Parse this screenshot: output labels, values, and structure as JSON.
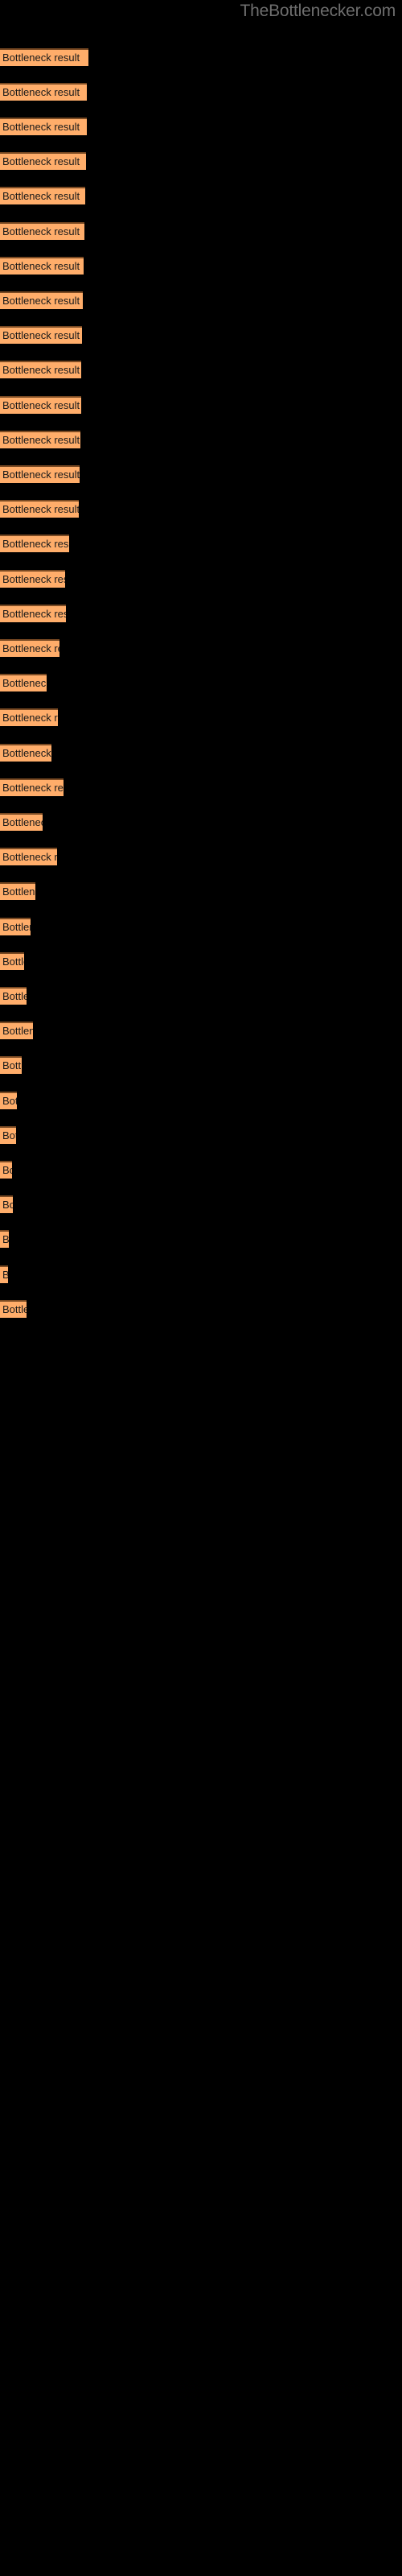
{
  "watermark": {
    "text": "TheBottlenecker.com",
    "color": "#6e6e6e"
  },
  "colors": {
    "background": "#000000",
    "bar_fill": "#ffad6a",
    "bar_border": "#7a4a23",
    "label_text": "#1a1a1a"
  },
  "chart_data": {
    "type": "bar",
    "orientation": "horizontal",
    "title": "",
    "subtitle": "",
    "xlabel": "",
    "ylabel": "",
    "grid": false,
    "legend": null,
    "axis_visible": false,
    "tick_labels": [],
    "xlim": [
      0,
      500
    ],
    "bar_label_text": "Bottleneck result",
    "categories": [
      "Bottleneck result",
      "Bottleneck result",
      "Bottleneck result",
      "Bottleneck result",
      "Bottleneck result",
      "Bottleneck result",
      "Bottleneck result",
      "Bottleneck result",
      "Bottleneck result",
      "Bottleneck result",
      "Bottleneck result",
      "Bottleneck result",
      "Bottleneck result",
      "Bottleneck result",
      "Bottleneck result",
      "Bottleneck result",
      "Bottleneck result",
      "Bottleneck result",
      "Bottleneck result",
      "Bottleneck result",
      "Bottleneck result",
      "Bottleneck result",
      "Bottleneck result",
      "Bottleneck result",
      "Bottleneck result",
      "Bottleneck result",
      "Bottleneck result",
      "Bottleneck result",
      "Bottleneck result",
      "Bottleneck result",
      "Bottleneck result",
      "Bottleneck result",
      "Bottleneck result",
      "Bottleneck result",
      "Bottleneck result",
      "Bottleneck result",
      "Bottleneck result"
    ],
    "values": [
      110,
      108,
      108,
      107,
      106,
      105,
      104,
      103,
      102,
      101,
      101,
      100,
      99,
      98,
      86,
      81,
      82,
      74,
      58,
      72,
      64,
      79,
      53,
      71,
      44,
      38,
      30,
      33,
      41,
      27,
      21,
      20,
      15,
      16,
      11,
      10,
      33
    ],
    "bars": [
      {
        "label": "Bottleneck result",
        "y": 60,
        "width": 110
      },
      {
        "label": "Bottleneck result",
        "y": 103,
        "width": 108
      },
      {
        "label": "Bottleneck result",
        "y": 146,
        "width": 108
      },
      {
        "label": "Bottleneck result",
        "y": 189,
        "width": 107
      },
      {
        "label": "Bottleneck result",
        "y": 232,
        "width": 106
      },
      {
        "label": "Bottleneck result",
        "y": 276,
        "width": 105
      },
      {
        "label": "Bottleneck result",
        "y": 319,
        "width": 104
      },
      {
        "label": "Bottleneck result",
        "y": 362,
        "width": 103
      },
      {
        "label": "Bottleneck result",
        "y": 405,
        "width": 102
      },
      {
        "label": "Bottleneck result",
        "y": 448,
        "width": 101
      },
      {
        "label": "Bottleneck result",
        "y": 492,
        "width": 101
      },
      {
        "label": "Bottleneck result",
        "y": 535,
        "width": 100
      },
      {
        "label": "Bottleneck result",
        "y": 578,
        "width": 99
      },
      {
        "label": "Bottleneck result",
        "y": 621,
        "width": 98
      },
      {
        "label": "Bottleneck result",
        "y": 664,
        "width": 86
      },
      {
        "label": "Bottleneck result",
        "y": 708,
        "width": 81
      },
      {
        "label": "Bottleneck result",
        "y": 751,
        "width": 82
      },
      {
        "label": "Bottleneck result",
        "y": 794,
        "width": 74
      },
      {
        "label": "Bottleneck result",
        "y": 837,
        "width": 58
      },
      {
        "label": "Bottleneck result",
        "y": 880,
        "width": 72
      },
      {
        "label": "Bottleneck result",
        "y": 924,
        "width": 64
      },
      {
        "label": "Bottleneck result",
        "y": 967,
        "width": 79
      },
      {
        "label": "Bottleneck result",
        "y": 1010,
        "width": 53
      },
      {
        "label": "Bottleneck result",
        "y": 1053,
        "width": 71
      },
      {
        "label": "Bottleneck result",
        "y": 1096,
        "width": 44
      },
      {
        "label": "Bottleneck result",
        "y": 1140,
        "width": 38
      },
      {
        "label": "Bottleneck result",
        "y": 1183,
        "width": 30
      },
      {
        "label": "Bottleneck result",
        "y": 1226,
        "width": 33
      },
      {
        "label": "Bottleneck result",
        "y": 1269,
        "width": 41
      },
      {
        "label": "Bottleneck result",
        "y": 1312,
        "width": 27
      },
      {
        "label": "Bottleneck result",
        "y": 1356,
        "width": 21
      },
      {
        "label": "Bottleneck result",
        "y": 1399,
        "width": 20
      },
      {
        "label": "Bottleneck result",
        "y": 1442,
        "width": 15
      },
      {
        "label": "Bottleneck result",
        "y": 1485,
        "width": 16
      },
      {
        "label": "Bottleneck result",
        "y": 1528,
        "width": 11
      },
      {
        "label": "Bottleneck result",
        "y": 1572,
        "width": 10
      },
      {
        "label": "Bottleneck result",
        "y": 1615,
        "width": 33
      }
    ]
  }
}
